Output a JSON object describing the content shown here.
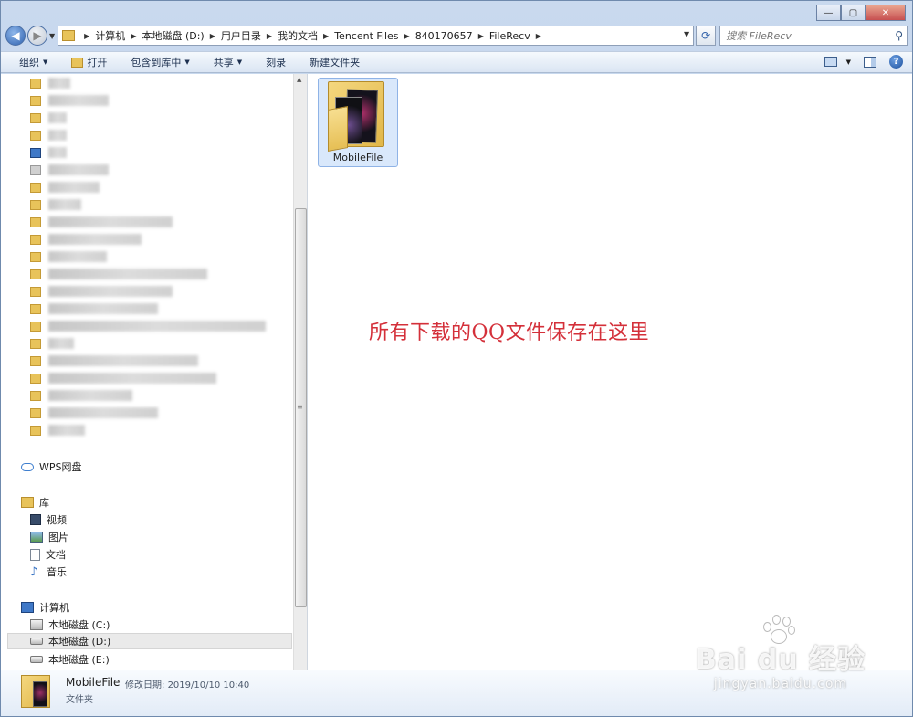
{
  "window": {
    "minimize_label": "—",
    "maximize_label": "▢",
    "close_label": "✕"
  },
  "address_bar": {
    "segments": [
      "计算机",
      "本地磁盘 (D:)",
      "用户目录",
      "我的文档",
      "Tencent Files",
      "840170657",
      "FileRecv"
    ],
    "search_placeholder": "搜索 FileRecv"
  },
  "toolbar": {
    "organize": "组织",
    "open": "打开",
    "include_in_library": "包含到库中",
    "share": "共享",
    "burn": "刻录",
    "new_folder": "新建文件夹"
  },
  "nav": {
    "wps": "WPS网盘",
    "library": "库",
    "videos": "视频",
    "pictures": "图片",
    "documents": "文档",
    "music": "音乐",
    "computer": "计算机",
    "drive_c": "本地磁盘 (C:)",
    "drive_d": "本地磁盘 (D:)",
    "drive_e": "本地磁盘 (E:)"
  },
  "content": {
    "items": [
      {
        "name": "MobileFile"
      }
    ],
    "annotation": "所有下载的QQ文件保存在这里"
  },
  "details": {
    "name": "MobileFile",
    "modified_label": "修改日期:",
    "modified_value": "2019/10/10 10:40",
    "type": "文件夹"
  },
  "watermark": {
    "brand": "Bai du 经验",
    "url": "jingyan.baidu.com"
  },
  "colors": {
    "annotation": "#d4303a",
    "selection": "#d9e8fb"
  }
}
